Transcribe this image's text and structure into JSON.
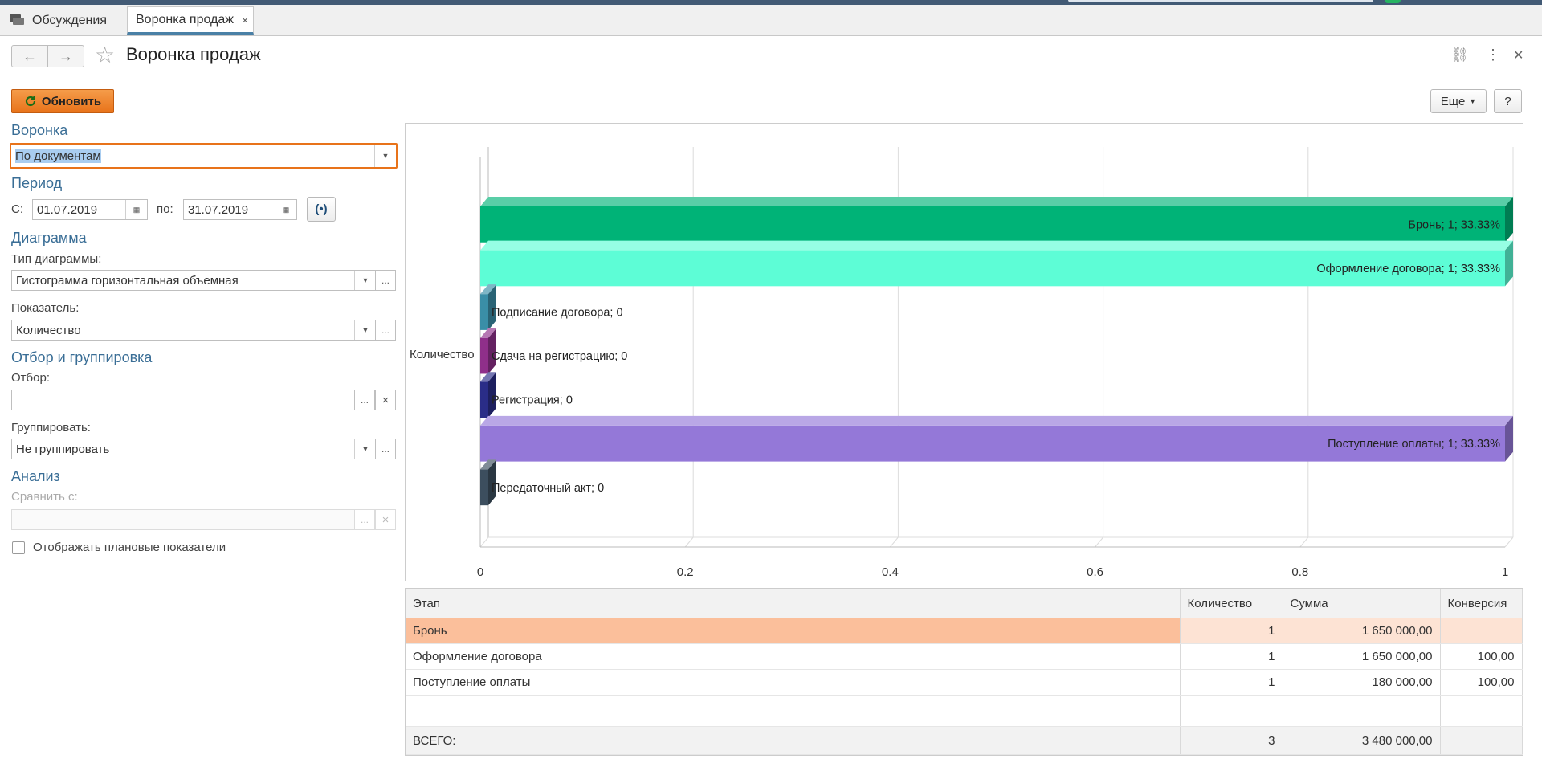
{
  "tabs": [
    {
      "label": "Обсуждения",
      "icon": "chat-icon"
    },
    {
      "label": "Воронка продаж",
      "closable": true
    }
  ],
  "close_glyph": "×",
  "nav": {
    "back_glyph": "←",
    "forward_glyph": "→",
    "star_glyph": "☆"
  },
  "page_title": "Воронка продаж",
  "header_icons": {
    "link": "⛓",
    "more": "⋮",
    "close": "✕"
  },
  "toolbar": {
    "refresh_label": "Обновить",
    "more_label": "Еще",
    "help_label": "?",
    "accent": "#e8731a"
  },
  "form": {
    "funnel_section": "Воронка",
    "funnel_value": "По документам",
    "period_section": "Период",
    "from_label": "С:",
    "from_value": "01.07.2019",
    "to_label": "по:",
    "to_value": "31.07.2019",
    "diagram_section": "Диаграмма",
    "chart_type_label": "Тип диаграммы:",
    "chart_type_value": "Гистограмма горизонтальная объемная",
    "indicator_label": "Показатель:",
    "indicator_value": "Количество",
    "filter_section": "Отбор и группировка",
    "filter_label": "Отбор:",
    "filter_value": "",
    "group_label": "Группировать:",
    "group_value": "Не группировать",
    "analysis_section": "Анализ",
    "compare_label": "Сравнить с:",
    "compare_value": "",
    "show_plan_label": "Отображать плановые показатели",
    "show_plan_checked": false,
    "ellipsis": "...",
    "clear": "×"
  },
  "chart_data": {
    "type": "bar",
    "orientation": "horizontal",
    "style": "3d",
    "category_label": "Количество",
    "xlim": [
      0,
      1
    ],
    "xticks": [
      "0",
      "0.2",
      "0.4",
      "0.6",
      "0.8",
      "1"
    ],
    "grid": true,
    "series": [
      {
        "name": "Бронь",
        "value": 1,
        "label": "Бронь; 1; 33.33%",
        "color": "#00b377"
      },
      {
        "name": "Оформление договора",
        "value": 1,
        "label": "Оформление договора; 1; 33.33%",
        "color": "#5dfdd6"
      },
      {
        "name": "Подписание договора",
        "value": 0,
        "label": "Подписание договора; 0",
        "color": "#3a8ea7"
      },
      {
        "name": "Сдача на регистрацию",
        "value": 0,
        "label": "Сдача на регистрацию; 0",
        "color": "#8f2f8a"
      },
      {
        "name": "Регистрация",
        "value": 0,
        "label": "Регистрация; 0",
        "color": "#2a2d88"
      },
      {
        "name": "Поступление оплаты",
        "value": 1,
        "label": "Поступление оплаты; 1; 33.33%",
        "color": "#9478d8"
      },
      {
        "name": "Передаточный акт",
        "value": 0,
        "label": "Передаточный акт; 0",
        "color": "#3c4e5e"
      }
    ]
  },
  "table": {
    "columns": [
      "Этап",
      "Количество",
      "Сумма",
      "Конверсия"
    ],
    "rows": [
      [
        "Бронь",
        "1",
        "1 650 000,00",
        ""
      ],
      [
        "Оформление договора",
        "1",
        "1 650 000,00",
        "100,00"
      ],
      [
        "Поступление оплаты",
        "1",
        "180 000,00",
        "100,00"
      ]
    ],
    "total": [
      "ВСЕГО:",
      "3",
      "3 480 000,00",
      ""
    ]
  }
}
